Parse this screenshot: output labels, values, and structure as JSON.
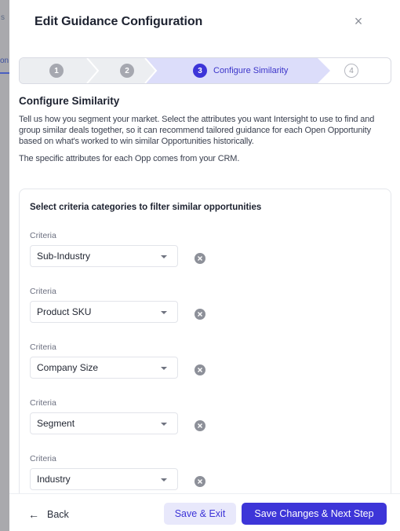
{
  "background": {
    "fragment_top": "s",
    "fragment_mid": "on"
  },
  "modal": {
    "title": "Edit Guidance Configuration",
    "close_glyph": "×"
  },
  "stepper": {
    "steps": [
      {
        "number": "1",
        "label": "",
        "state": "done"
      },
      {
        "number": "2",
        "label": "",
        "state": "done"
      },
      {
        "number": "3",
        "label": "Configure Similarity",
        "state": "active"
      },
      {
        "number": "4",
        "label": "",
        "state": "todo"
      }
    ]
  },
  "section": {
    "title": "Configure Similarity",
    "paragraph1": "Tell us how you segment your market. Select the attributes you want Intersight to use to find and group similar deals together, so it can recommend tailored guidance for each Open Opportunity based on what's worked to win similar Opportunities historically.",
    "paragraph2": "The specific attributes for each Opp comes from your CRM."
  },
  "criteria_card": {
    "title": "Select criteria categories to filter similar opportunities",
    "items": [
      {
        "label": "Criteria",
        "value": "Sub-Industry"
      },
      {
        "label": "Criteria",
        "value": "Product SKU"
      },
      {
        "label": "Criteria",
        "value": "Company Size"
      },
      {
        "label": "Criteria",
        "value": "Segment"
      },
      {
        "label": "Criteria",
        "value": "Industry"
      }
    ]
  },
  "footer": {
    "back_label": "Back",
    "back_arrow": "←",
    "save_exit_label": "Save & Exit",
    "save_next_label": "Save Changes & Next Step"
  },
  "colors": {
    "accent": "#3d35d8",
    "accent_light": "#e8e8fb",
    "step_done_bg": "#eceef1",
    "step_active_bg": "#dcddfa"
  }
}
